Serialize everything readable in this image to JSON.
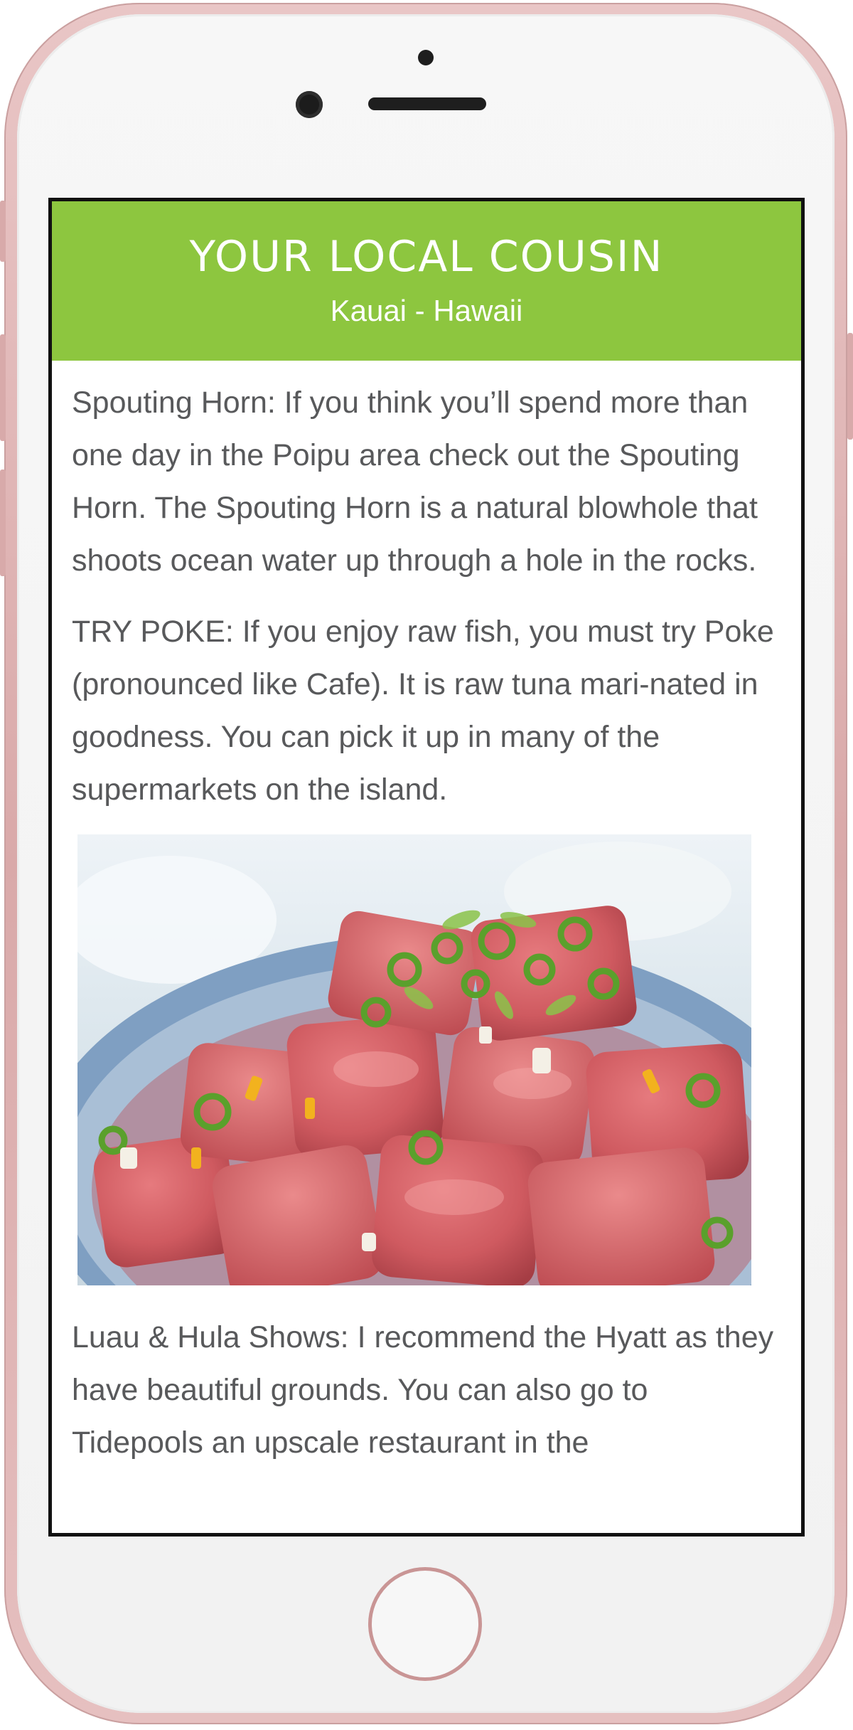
{
  "app": {
    "title": "YOUR LOCAL COUSIN",
    "subtitle": "Kauai - Hawaii",
    "brand_color": "#8dc63f",
    "text_color": "#58595b"
  },
  "paragraphs": {
    "spouting_horn": "Spouting Horn: If you think you’ll spend more than one day in the Poipu area check out the Spouting Horn. The Spouting Horn is a natural blowhole that shoots ocean water up through a hole in the rocks.",
    "try_poke": "TRY POKE: If you enjoy raw fish, you must try Poke (pronounced like Cafe). It is raw tuna mari-nated in goodness. You can pick it up in many of the supermarkets on the island.",
    "luau": "Luau & Hula Shows: I recommend the Hyatt as they have beautiful grounds. You can also go to Tidepools an upscale restaurant in the"
  },
  "image": {
    "subject": "poke bowl: cubed raw tuna with green onions in a blue bowl"
  },
  "device": {
    "color": "rose-gold"
  }
}
